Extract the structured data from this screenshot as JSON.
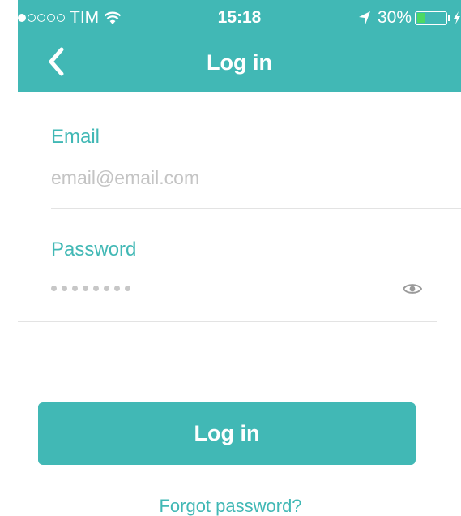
{
  "colors": {
    "accent": "#41b8b5",
    "divider": "#e3e3e3",
    "placeholder": "#c4c4c4",
    "battery": "#4cd964"
  },
  "status_bar": {
    "carrier": "TIM",
    "signal_bars_filled": 1,
    "signal_bars_total": 5,
    "time": "15:18",
    "battery_percent_label": "30%",
    "battery_level": 0.3,
    "icons": [
      "signal-icon",
      "wifi-icon",
      "location-arrow-icon",
      "battery-icon",
      "charging-bolt-icon"
    ]
  },
  "nav": {
    "title": "Log in",
    "back_icon": "chevron-left-icon"
  },
  "form": {
    "email": {
      "label": "Email",
      "placeholder": "email@email.com",
      "value": ""
    },
    "password": {
      "label": "Password",
      "masked_length": 8,
      "toggle_icon": "eye-icon"
    }
  },
  "actions": {
    "login_label": "Log in",
    "forgot_label": "Forgot password?"
  }
}
